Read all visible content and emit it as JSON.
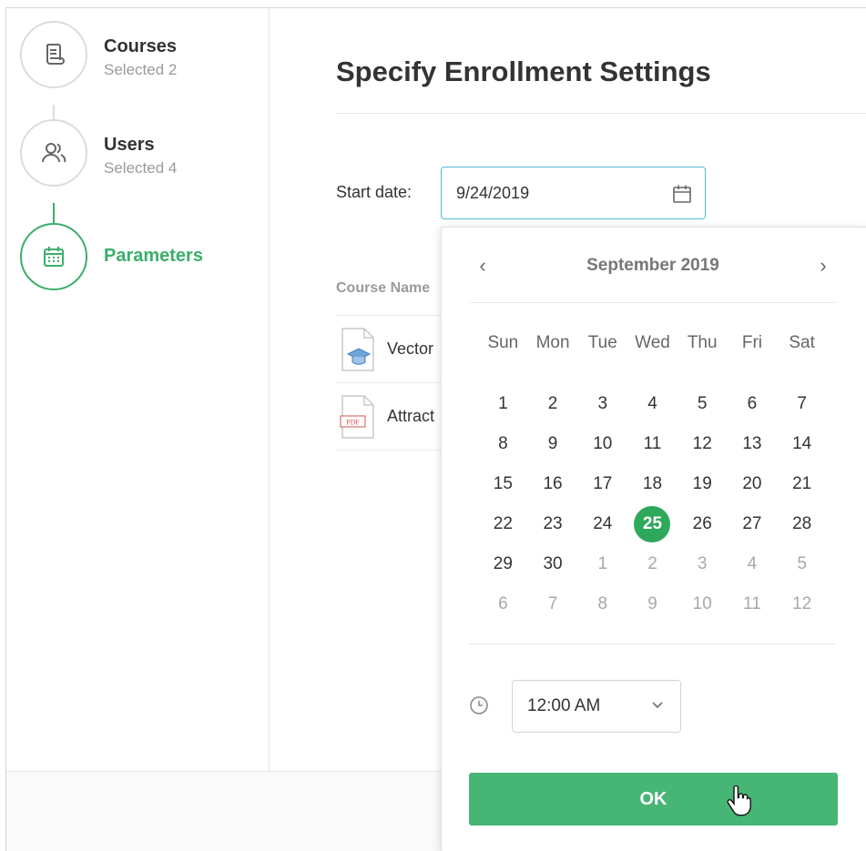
{
  "wizard": {
    "steps": [
      {
        "title": "Courses",
        "subtitle": "Selected 2",
        "icon": "document-scroll-icon",
        "state": "done"
      },
      {
        "title": "Users",
        "subtitle": "Selected 4",
        "icon": "users-icon",
        "state": "done"
      },
      {
        "title": "Parameters",
        "subtitle": "",
        "icon": "calendar-icon",
        "state": "active"
      }
    ]
  },
  "main": {
    "title": "Specify Enrollment Settings",
    "start_date_label": "Start date:",
    "start_date_value": "9/24/2019",
    "course_column_header": "Course Name",
    "courses": [
      {
        "name": "Vector",
        "icon": "course-package-icon"
      },
      {
        "name": "Attract",
        "icon": "pdf-document-icon"
      }
    ]
  },
  "calendar": {
    "month_label": "September 2019",
    "prev_arrow": "‹",
    "next_arrow": "›",
    "weekdays": [
      "Sun",
      "Mon",
      "Tue",
      "Wed",
      "Thu",
      "Fri",
      "Sat"
    ],
    "weeks": [
      [
        "1",
        "2",
        "3",
        "4",
        "5",
        "6",
        "7"
      ],
      [
        "8",
        "9",
        "10",
        "11",
        "12",
        "13",
        "14"
      ],
      [
        "15",
        "16",
        "17",
        "18",
        "19",
        "20",
        "21"
      ],
      [
        "22",
        "23",
        "24",
        "25",
        "26",
        "27",
        "28"
      ],
      [
        "29",
        "30",
        "1",
        "2",
        "3",
        "4",
        "5"
      ],
      [
        "6",
        "7",
        "8",
        "9",
        "10",
        "11",
        "12"
      ]
    ],
    "selected_day": "25",
    "time_value": "12:00 AM",
    "ok_label": "OK"
  },
  "colors": {
    "accent": "#3aae6a",
    "selected_day": "#2ea85a",
    "ok_button": "#47b574",
    "input_focus_border": "#52b8d6"
  }
}
